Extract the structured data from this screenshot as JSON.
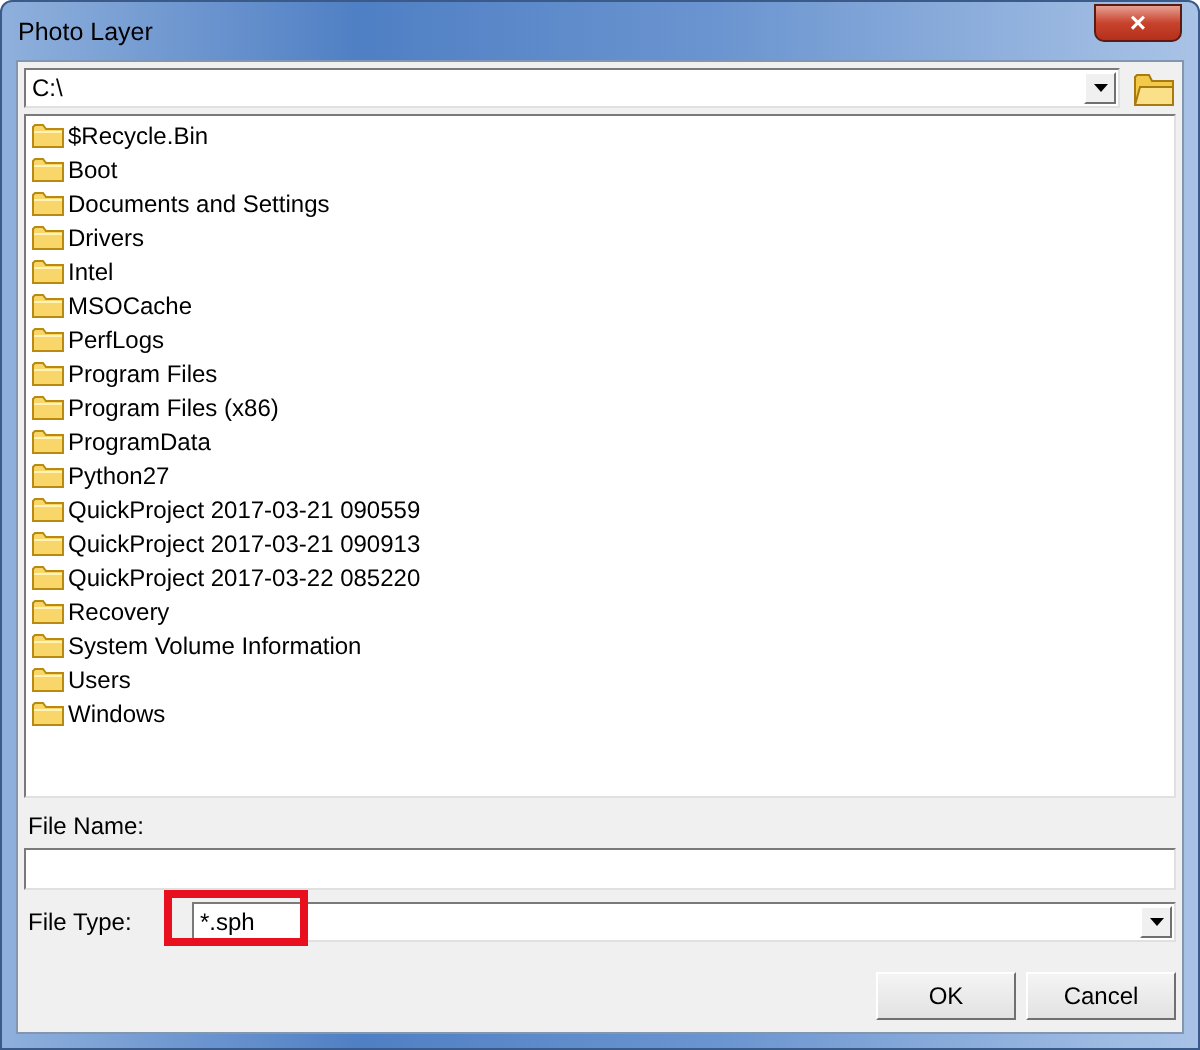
{
  "window": {
    "title": "Photo Layer",
    "close": "×"
  },
  "path": {
    "value": "C:\\"
  },
  "folders": [
    {
      "name": "$Recycle.Bin"
    },
    {
      "name": "Boot"
    },
    {
      "name": "Documents and Settings"
    },
    {
      "name": "Drivers"
    },
    {
      "name": "Intel"
    },
    {
      "name": "MSOCache"
    },
    {
      "name": "PerfLogs"
    },
    {
      "name": "Program Files"
    },
    {
      "name": "Program Files (x86)"
    },
    {
      "name": "ProgramData"
    },
    {
      "name": "Python27"
    },
    {
      "name": "QuickProject 2017-03-21 090559"
    },
    {
      "name": "QuickProject 2017-03-21 090913"
    },
    {
      "name": "QuickProject 2017-03-22 085220"
    },
    {
      "name": "Recovery"
    },
    {
      "name": "System Volume Information"
    },
    {
      "name": "Users"
    },
    {
      "name": "Windows"
    }
  ],
  "file_name": {
    "label": "File Name:"
  },
  "file_type": {
    "label": "File Type:",
    "value": "*.sph",
    "highlighted": true
  },
  "buttons": [
    {
      "label": "OK"
    },
    {
      "label": "Cancel"
    }
  ]
}
